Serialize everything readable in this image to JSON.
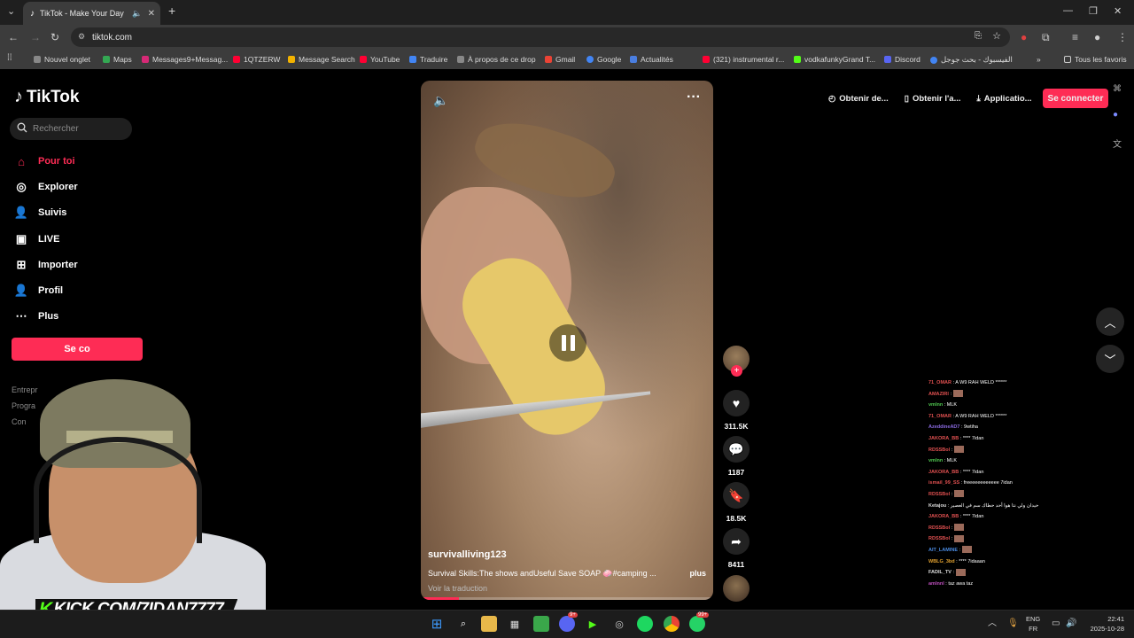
{
  "browser": {
    "tab_title": "TikTok - Make Your Day",
    "url": "tiktok.com",
    "bookmarks": [
      "Nouvel onglet",
      "Maps",
      "Messages9+Messag...",
      "1QTZERW",
      "Message Search",
      "YouTube",
      "Traduire",
      "À propos de ce drop",
      "Gmail",
      "Google",
      "Actualités",
      "(321) instrumental r...",
      "vodkafunkyGrand T...",
      "Discord",
      "الفيسبوك - بحث جوجل"
    ],
    "all_bookmarks": "Tous les favoris"
  },
  "tiktok": {
    "logo": "TikTok",
    "search_placeholder": "Rechercher",
    "nav": [
      "Pour toi",
      "Explorer",
      "Suivis",
      "LIVE",
      "Importer",
      "Profil",
      "Plus"
    ],
    "login_label": "Se co",
    "footer": [
      "Entrepr",
      "Progra",
      "Con"
    ],
    "top_actions": [
      "Obtenir de...",
      "Obtenir l'a...",
      "Applicatio..."
    ],
    "connect": "Se connecter"
  },
  "video": {
    "username": "survivalliving123",
    "description": "Survival Skills:The shows andUseful Save SOAP 🧼#camping ...",
    "more": "plus",
    "translate": "Voir la traduction",
    "progress": 0.13,
    "likes": "311.5K",
    "comments": "1187",
    "saves": "18.5K",
    "shares": "8411"
  },
  "overlay": {
    "kick_banner": "KICK.COM/7IDAN7777",
    "chat": [
      {
        "user": "71_OMAR",
        "msg": "A W9 RAH WELD ******",
        "color": "#e05050"
      },
      {
        "user": "AMAZIRI",
        "msg": "",
        "color": "#e05050",
        "emote": true
      },
      {
        "user": "vmlnn",
        "msg": "MLK",
        "color": "#50c850"
      },
      {
        "user": "71_OMAR",
        "msg": "A W9 RAH WELD ******",
        "color": "#e05050"
      },
      {
        "user": "AzeddineAD7",
        "msg": "9wtiha",
        "color": "#8a6ae0"
      },
      {
        "user": "JAKORA_BB",
        "msg": "**** 7idan",
        "color": "#e05050"
      },
      {
        "user": "RDSSBol",
        "msg": "",
        "color": "#e05050",
        "emote": true
      },
      {
        "user": "vmlnn",
        "msg": "MLK",
        "color": "#50c850"
      },
      {
        "user": "JAKORA_BB",
        "msg": "**** 7idan",
        "color": "#e05050"
      },
      {
        "user": "ismail_99_SS",
        "msg": "freeeeeeeeeeee 7idan",
        "color": "#e05050"
      },
      {
        "user": "RDSSBol",
        "msg": "",
        "color": "#e05050",
        "emote": true
      },
      {
        "user": "Ketajou",
        "msg": "حيدان ولي نتا هوا أحد حطاك سم في العصير",
        "color": "#dddddd"
      },
      {
        "user": "JAKORA_BB",
        "msg": "**** 7idan",
        "color": "#e05050"
      },
      {
        "user": "RDSSBol",
        "msg": "",
        "color": "#e05050",
        "emote": true
      },
      {
        "user": "RDSSBol",
        "msg": "",
        "color": "#e05050",
        "emote": true
      },
      {
        "user": "AIT_LAMINE",
        "msg": "",
        "color": "#4a8ae0",
        "emote": true
      },
      {
        "user": "WBLG_3bd",
        "msg": "**** 7idaaan",
        "color": "#e0a030"
      },
      {
        "user": "FADIL_TV",
        "msg": "",
        "color": "#dddddd",
        "emote": true
      },
      {
        "user": "amlnnl",
        "msg": "taz awa taz",
        "color": "#c050c0"
      }
    ]
  },
  "taskbar": {
    "lang": "ENG",
    "locale": "FR",
    "time": "22:41",
    "date": "2025-10-28",
    "badge1": "9+",
    "badge2": "99+"
  },
  "colors": {
    "accent": "#fe2c55",
    "kick_green": "#53fc18"
  }
}
